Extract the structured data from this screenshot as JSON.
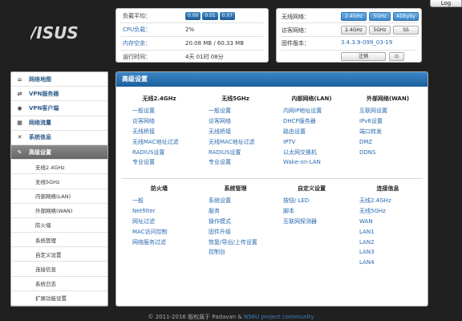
{
  "logo": {
    "text": "/ISUS"
  },
  "logout_label": "Log",
  "status": {
    "rows": [
      {
        "key": "负载平均：",
        "loads": [
          "0.00",
          "0.01",
          "0.07"
        ]
      },
      {
        "key": "CPU负载：",
        "value": "2%"
      },
      {
        "key": "内存空余：",
        "value": "20.08 MB / 60.33 MB"
      },
      {
        "key": "运行时间：",
        "value": "4天 01时 08分"
      }
    ]
  },
  "wifi": {
    "wireless_label": "无线网络：",
    "wireless_buttons": [
      "2.4GHz",
      "5GHz",
      "ADbyby"
    ],
    "guest_label": "访客网络：",
    "guest_buttons": [
      "2.4GHz",
      "5GHz",
      "SS"
    ],
    "firmware_label": "固件版本：",
    "firmware_value": "3.4.3.9-099_03-19",
    "logout_btn": "注销",
    "power_icon": "⏻"
  },
  "sidebar": {
    "items": [
      {
        "icon": "⌂",
        "label": "网络地图"
      },
      {
        "icon": "⇄",
        "label": "VPN服务器"
      },
      {
        "icon": "◉",
        "label": "VPN客户端"
      },
      {
        "icon": "▦",
        "label": "网络流量"
      },
      {
        "icon": "✕",
        "label": "系统信息"
      },
      {
        "icon": "✎",
        "label": "高级设置"
      }
    ],
    "sub_items": [
      "无线2.4GHz",
      "无线5GHz",
      "内部网络(LAN)",
      "外部网络(WAN)",
      "防火墙",
      "系统管理",
      "自定义设置",
      "连接信息",
      "系统日志",
      "扩展功能设置"
    ]
  },
  "content": {
    "title": "高级设置",
    "sections_top": [
      {
        "head": "无线2.4GHz",
        "items": [
          "一般设置",
          "访客网络",
          "无线桥接",
          "无线MAC地址过滤",
          "RADIUS设置",
          "专业设置"
        ]
      },
      {
        "head": "无线5GHz",
        "items": [
          "一般设置",
          "访客网络",
          "无线桥接",
          "无线MAC地址过滤",
          "RADIUS设置",
          "专业设置"
        ]
      },
      {
        "head": "内部网络(LAN)",
        "items": [
          "内网IP地址设置",
          "DHCP服务器",
          "路由设置",
          "IPTV",
          "以太网交换机",
          "Wake-on-LAN"
        ]
      },
      {
        "head": "外部网络(WAN)",
        "items": [
          "互联网设置",
          "IPv6设置",
          "端口转发",
          "DMZ",
          "DDNS"
        ]
      }
    ],
    "sections_bottom": [
      {
        "head": "防火墙",
        "items": [
          "一般",
          "Netfilter",
          "网址过滤",
          "MAC访问控制",
          "网络服务过滤"
        ]
      },
      {
        "head": "系统管理",
        "items": [
          "系统设置",
          "服务",
          "操作模式",
          "固件升级",
          "恢复/导出/上传设置",
          "控制台"
        ]
      },
      {
        "head": "自定义设置",
        "items": [
          "按钮/ LED",
          "脚本",
          "互联网探测器"
        ]
      },
      {
        "head": "连接信息",
        "items": [
          "无线2.4GHz",
          "无线5GHz",
          "WAN",
          "LAN1",
          "LAN2",
          "LAN3",
          "LAN4"
        ]
      }
    ]
  },
  "footer": {
    "text": "© 2011-2016 版权属于 Padavan & ",
    "link": "N56U project community"
  },
  "colors": {
    "accent": "#2a6bb0",
    "header_blue": "#1d5f9c",
    "background": "#202020"
  }
}
